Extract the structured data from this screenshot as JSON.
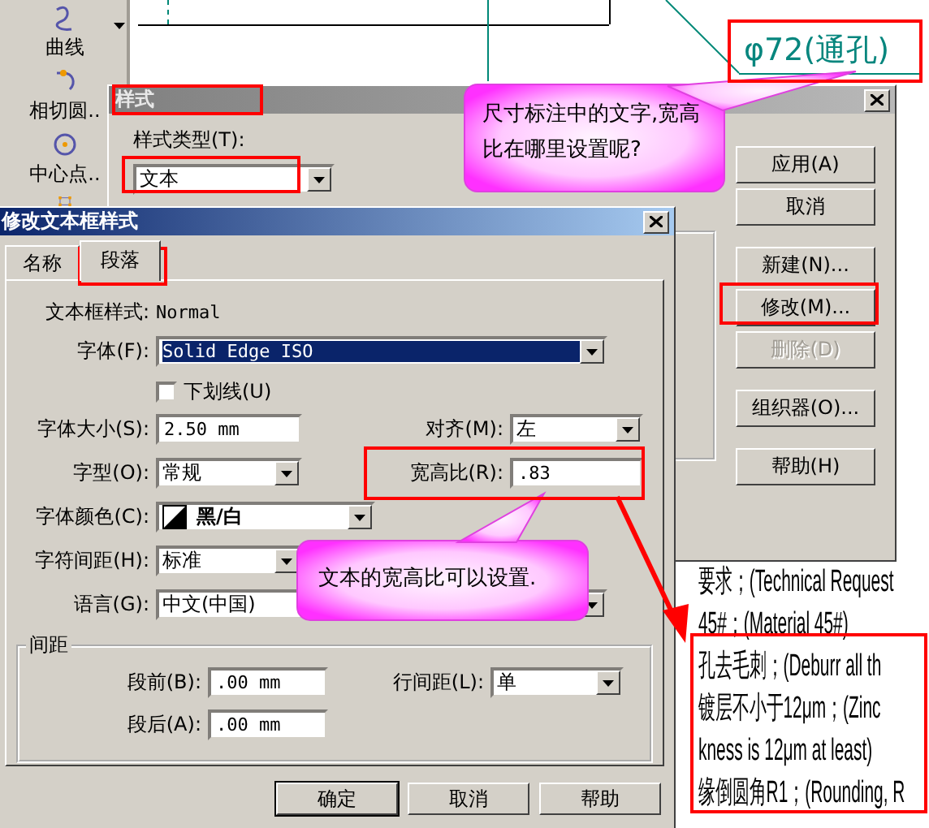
{
  "toolbar": {
    "items": [
      {
        "label": "曲线"
      },
      {
        "label": "相切圆.."
      },
      {
        "label": "中心点.."
      }
    ]
  },
  "drawing": {
    "dimension": "φ72(通孔)",
    "notes": [
      "要求；(Technical Request",
      "45#；(Material 45#)",
      "孔去毛刺；(Deburr all th",
      "镀层不小于12μm；(Zinc",
      "kness is 12μm at least)",
      "缘倒圆角R1；(Rounding, R"
    ]
  },
  "style_dialog": {
    "title": "样式",
    "style_type": {
      "label": "样式类型(T):",
      "value": "文本"
    },
    "buttons": [
      {
        "label": "应用(A)",
        "disabled": false
      },
      {
        "label": "取消",
        "disabled": false
      },
      {
        "label": "新建(N)...",
        "disabled": false
      },
      {
        "label": "修改(M)...",
        "disabled": false
      },
      {
        "label": "删除(D)",
        "disabled": true
      },
      {
        "label": "组织器(O)...",
        "disabled": false
      },
      {
        "label": "帮助(H)",
        "disabled": false
      }
    ]
  },
  "text_style_dialog": {
    "title": "修改文本框样式",
    "tabs": [
      {
        "label": "名称",
        "selected": false
      },
      {
        "label": "段落",
        "selected": true
      }
    ],
    "rows": [
      [
        {
          "kind": "static",
          "label": "文本框样式:",
          "value": "Normal"
        }
      ],
      [
        {
          "kind": "combo",
          "label": "字体(F):",
          "value": "Solid Edge ISO",
          "highlighted": true
        }
      ],
      [
        {
          "kind": "checkbox",
          "label": "下划线(U)",
          "checked": false
        }
      ],
      [
        {
          "kind": "input",
          "label": "字体大小(S):",
          "value": "2.50 mm"
        },
        {
          "kind": "combo",
          "label": "对齐(M):",
          "value": "左",
          "highlighted": false
        }
      ],
      [
        {
          "kind": "combo",
          "label": "字型(O):",
          "value": "常规",
          "highlighted": false
        },
        {
          "kind": "input",
          "label": "宽高比(R):",
          "value": ".83"
        }
      ],
      [
        {
          "kind": "color",
          "label": "字体颜色(C):",
          "value": "黑/白"
        }
      ],
      [
        {
          "kind": "combo",
          "label": "字符间距(H):",
          "value": "标准",
          "highlighted": false
        }
      ],
      [
        {
          "kind": "combo",
          "label": "语言(G):",
          "value": "中文(中国)",
          "highlighted": false
        }
      ]
    ],
    "spacing": {
      "title": "间距",
      "rows": [
        [
          {
            "kind": "input",
            "label": "段前(B):",
            "value": ".00 mm"
          },
          {
            "kind": "combo",
            "label": "行间距(L):",
            "value": "单",
            "highlighted": false
          }
        ],
        [
          {
            "kind": "input",
            "label": "段后(A):",
            "value": ".00 mm"
          }
        ]
      ]
    },
    "buttons": [
      {
        "label": "确定",
        "default": true
      },
      {
        "label": "取消",
        "default": false
      },
      {
        "label": "帮助",
        "default": false
      }
    ]
  },
  "callouts": [
    {
      "text": "尺寸标注中的文字,宽高比在哪里设置呢?"
    },
    {
      "text": "文本的宽高比可以设置."
    }
  ]
}
